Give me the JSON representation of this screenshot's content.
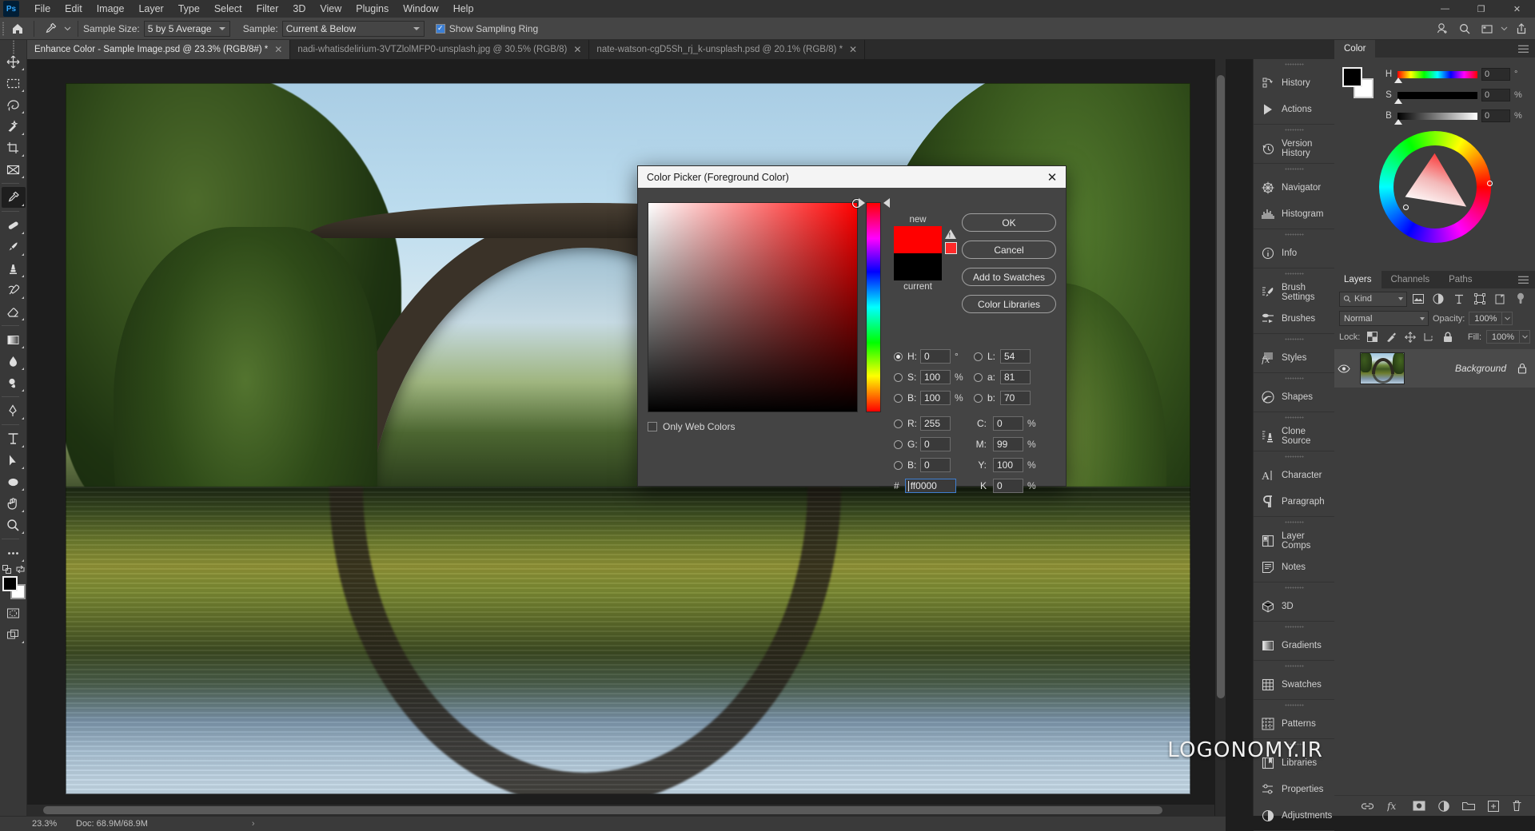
{
  "app": {
    "logo": "Ps",
    "menus": [
      "File",
      "Edit",
      "Image",
      "Layer",
      "Type",
      "Select",
      "Filter",
      "3D",
      "View",
      "Plugins",
      "Window",
      "Help"
    ],
    "window_controls": {
      "minimize": "—",
      "restore": "❐",
      "close": "✕"
    }
  },
  "options_bar": {
    "tool_icon": "eyedropper-icon",
    "home_icon": "home-icon",
    "sample_size_label": "Sample Size:",
    "sample_size_value": "5 by 5 Average",
    "sample_label": "Sample:",
    "sample_value": "Current & Below",
    "show_sampling_ring_label": "Show Sampling Ring",
    "show_sampling_ring_checked": true,
    "right_icons": [
      "workspace-icon",
      "search-icon",
      "panel-icon",
      "share-icon"
    ]
  },
  "tabs": [
    {
      "label": "Enhance Color - Sample Image.psd @ 23.3% (RGB/8#) *",
      "active": true,
      "close": "✕"
    },
    {
      "label": "nadi-whatisdelirium-3VTZlolMFP0-unsplash.jpg @ 30.5% (RGB/8)",
      "active": false,
      "close": "✕"
    },
    {
      "label": "nate-watson-cgD5Sh_rj_k-unsplash.psd @ 20.1% (RGB/8) *",
      "active": false,
      "close": "✕"
    }
  ],
  "toolbar": {
    "tools": [
      {
        "name": "move-tool",
        "glyph": "move"
      },
      {
        "name": "marquee-tool",
        "glyph": "marquee"
      },
      {
        "name": "lasso-tool",
        "glyph": "lasso"
      },
      {
        "name": "magic-wand-tool",
        "glyph": "wand"
      },
      {
        "name": "crop-tool",
        "glyph": "crop"
      },
      {
        "name": "frame-tool",
        "glyph": "frame"
      },
      {
        "name": "eyedropper-tool",
        "glyph": "eyedropper",
        "active": true
      },
      {
        "name": "healing-brush-tool",
        "glyph": "heal"
      },
      {
        "name": "brush-tool",
        "glyph": "brush"
      },
      {
        "name": "clone-stamp-tool",
        "glyph": "stamp"
      },
      {
        "name": "history-brush-tool",
        "glyph": "historybrush"
      },
      {
        "name": "eraser-tool",
        "glyph": "eraser"
      },
      {
        "name": "gradient-tool",
        "glyph": "gradient"
      },
      {
        "name": "blur-tool",
        "glyph": "blur"
      },
      {
        "name": "dodge-tool",
        "glyph": "dodge"
      },
      {
        "name": "pen-tool",
        "glyph": "pen"
      },
      {
        "name": "type-tool",
        "glyph": "type"
      },
      {
        "name": "path-selection-tool",
        "glyph": "arrow"
      },
      {
        "name": "ellipse-tool",
        "glyph": "ellipse"
      },
      {
        "name": "hand-tool",
        "glyph": "hand"
      },
      {
        "name": "zoom-tool",
        "glyph": "zoom"
      },
      {
        "name": "edit-toolbar-tool",
        "glyph": "dots"
      }
    ],
    "foreground_color": "#000000",
    "background_color": "#ffffff",
    "quick_mask_name": "quick-mask-toggle",
    "screen_mode_name": "screen-mode-toggle"
  },
  "status_bar": {
    "zoom": "23.3%",
    "doc": "Doc: 68.9M/68.9M",
    "caret": "›"
  },
  "icon_dock": {
    "groups": [
      [
        {
          "label": "History",
          "icon": "history-icon"
        },
        {
          "label": "Actions",
          "icon": "actions-play-icon"
        }
      ],
      [
        {
          "label": "Version History",
          "icon": "version-history-clock-icon"
        }
      ],
      [
        {
          "label": "Navigator",
          "icon": "navigator-icon"
        },
        {
          "label": "Histogram",
          "icon": "histogram-icon"
        }
      ],
      [
        {
          "label": "Info",
          "icon": "info-circle-icon"
        }
      ],
      [
        {
          "label": "Brush Settings",
          "icon": "brush-settings-icon"
        },
        {
          "label": "Brushes",
          "icon": "brushes-icon"
        }
      ],
      [
        {
          "label": "Styles",
          "icon": "styles-fx-icon"
        }
      ],
      [
        {
          "label": "Shapes",
          "icon": "shapes-icon"
        }
      ],
      [
        {
          "label": "Clone Source",
          "icon": "clone-source-icon"
        }
      ],
      [
        {
          "label": "Character",
          "icon": "character-icon"
        },
        {
          "label": "Paragraph",
          "icon": "paragraph-icon"
        }
      ],
      [
        {
          "label": "Layer Comps",
          "icon": "layer-comps-icon"
        },
        {
          "label": "Notes",
          "icon": "notes-icon"
        }
      ],
      [
        {
          "label": "3D",
          "icon": "cube-3d-icon"
        }
      ],
      [
        {
          "label": "Gradients",
          "icon": "gradients-icon"
        }
      ],
      [
        {
          "label": "Swatches",
          "icon": "swatches-grid-icon"
        }
      ],
      [
        {
          "label": "Patterns",
          "icon": "patterns-icon"
        }
      ],
      [
        {
          "label": "Libraries",
          "icon": "libraries-book-icon"
        },
        {
          "label": "Properties",
          "icon": "properties-sliders-icon"
        },
        {
          "label": "Adjustments",
          "icon": "adjustments-half-circle-icon"
        }
      ]
    ]
  },
  "color_panel": {
    "tab_label": "Color",
    "menu_icon": "panel-menu-icon",
    "foreground": "#000000",
    "background": "#ffffff",
    "sliders": [
      {
        "label": "H",
        "value": "0",
        "unit": "°"
      },
      {
        "label": "S",
        "value": "0",
        "unit": "%"
      },
      {
        "label": "B",
        "value": "0",
        "unit": "%"
      }
    ]
  },
  "layers_panel": {
    "tabs": [
      "Layers",
      "Channels",
      "Paths"
    ],
    "active_tab": "Layers",
    "menu_icon": "panel-menu-icon",
    "filter_label": "Kind",
    "filter_icon": "search-icon",
    "filter_type_icons": [
      "pixel-filter-icon",
      "adjustment-filter-icon",
      "type-filter-icon",
      "shape-filter-icon",
      "smart-object-filter-icon",
      "filter-toggle-icon"
    ],
    "blend_mode": "Normal",
    "opacity_label": "Opacity:",
    "opacity_value": "100%",
    "lock_label": "Lock:",
    "lock_icons": [
      "lock-transparency-icon",
      "lock-image-icon",
      "lock-position-icon",
      "lock-artboard-icon",
      "lock-all-icon"
    ],
    "fill_label": "Fill:",
    "fill_value": "100%",
    "layers": [
      {
        "name": "Background",
        "visible": true,
        "locked": true,
        "eye_icon": "eye-icon",
        "lock_icon": "lock-icon"
      }
    ],
    "bottom_icons": [
      "link-layers-icon",
      "fx-icon",
      "layer-mask-icon",
      "adjustment-layer-icon",
      "new-group-icon",
      "new-layer-icon",
      "delete-layer-icon"
    ]
  },
  "watermark": "LOGONOMY.IR",
  "color_picker": {
    "title": "Color Picker (Foreground Color)",
    "close_icon": "close-icon",
    "new_label": "new",
    "current_label": "current",
    "new_color": "#ff0000",
    "current_color": "#000000",
    "gamut_warning_icon": "out-of-gamut-warning-icon",
    "gamut_warning_color": "#ff2a2a",
    "buttons": [
      {
        "label": "OK",
        "name": "ok-button"
      },
      {
        "label": "Cancel",
        "name": "cancel-button"
      },
      {
        "label": "Add to Swatches",
        "name": "add-to-swatches-button"
      },
      {
        "label": "Color Libraries",
        "name": "color-libraries-button"
      }
    ],
    "only_web_colors_label": "Only Web Colors",
    "only_web_colors_checked": false,
    "hsb": [
      {
        "label": "H",
        "value": "0",
        "unit": "°",
        "selected": true
      },
      {
        "label": "S",
        "value": "100",
        "unit": "%",
        "selected": false
      },
      {
        "label": "B",
        "value": "100",
        "unit": "%",
        "selected": false
      }
    ],
    "lab": [
      {
        "label": "L",
        "value": "54",
        "unit": "",
        "selected": false
      },
      {
        "label": "a",
        "value": "81",
        "unit": "",
        "selected": false
      },
      {
        "label": "b",
        "value": "70",
        "unit": "",
        "selected": false
      }
    ],
    "rgb": [
      {
        "label": "R",
        "value": "255",
        "selected": false
      },
      {
        "label": "G",
        "value": "0",
        "selected": false
      },
      {
        "label": "B",
        "value": "0",
        "selected": false
      }
    ],
    "cmyk": [
      {
        "label": "C",
        "value": "0",
        "unit": "%"
      },
      {
        "label": "M",
        "value": "99",
        "unit": "%"
      },
      {
        "label": "Y",
        "value": "100",
        "unit": "%"
      },
      {
        "label": "K",
        "value": "0",
        "unit": "%"
      }
    ],
    "hex_symbol": "#",
    "hex_value": "ff0000"
  }
}
